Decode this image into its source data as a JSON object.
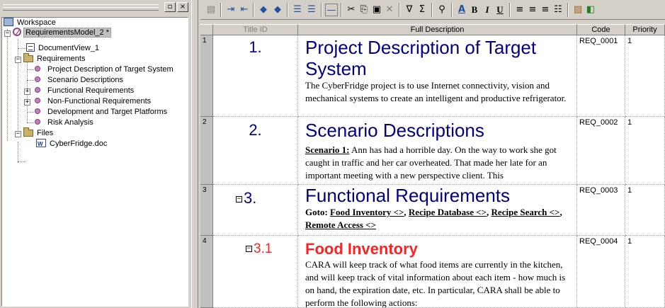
{
  "left_panel": {
    "close_label": "×",
    "restore_label": "▫",
    "tree": {
      "workspace": "Workspace",
      "model": "RequirementsModel_2 *",
      "document_view": "DocumentView_1",
      "requirements": "Requirements",
      "items": [
        "Project Description of Target System",
        "Scenario Descriptions",
        "Functional Requirements",
        "Non-Functional Requirements",
        "Development and Target Platforms",
        "Risk Analysis"
      ],
      "files": "Files",
      "file": "CyberFridge.doc",
      "expand_plus": "+",
      "expand_minus": "−"
    }
  },
  "toolbar": {
    "icons": [
      "properties-icon",
      "insert-row-icon",
      "insert-col-icon",
      "arrow-left-icon",
      "arrow-right-icon",
      "align-left-icon",
      "align-center-icon",
      "line-icon",
      "cut-icon",
      "copy-icon",
      "paste-icon",
      "delete-icon",
      "filter-icon",
      "sum-icon",
      "find-icon",
      "font-color-icon",
      "bold-icon",
      "italic-icon",
      "underline-icon",
      "align-justify-icon",
      "align-center2-icon",
      "align-right-icon",
      "bullets-icon",
      "image-icon",
      "export-icon"
    ],
    "glyphs": {
      "bold": "B",
      "italic": "I",
      "underline": "U",
      "font_color": "A"
    }
  },
  "grid": {
    "columns": {
      "title_id": "Title ID",
      "full_description": "Full Description",
      "code": "Code",
      "priority": "Priority"
    },
    "rows": [
      {
        "row_num": "1",
        "title_num": "1.",
        "heading": "Project Description of Target System",
        "text": "The CyberFridge project is to use Internet connectivity, vision and mechanical systems to create an intelligent and productive refrigerator.",
        "code": "REQ_0001",
        "priority": "1"
      },
      {
        "row_num": "2",
        "title_num": "2.",
        "heading": "Scenario Descriptions",
        "scenario_label": "Scenario 1:",
        "text": " Ann has had a horrible day. On the way to work she got caught in traffic and her car overheated. That made her late for an important meeting with a new perspective client. This",
        "code": "REQ_0002",
        "priority": "1"
      },
      {
        "row_num": "3",
        "title_num": "3.",
        "heading": "Functional Requirements",
        "goto_label": "Goto:",
        "links": [
          "Food Inventory <>",
          "Recipe Database <>",
          "Recipe Search <>",
          "Remote Access <>"
        ],
        "code": "REQ_0003",
        "priority": "1"
      },
      {
        "row_num": "4",
        "title_num": "3.1",
        "heading": "Food Inventory",
        "text": "CARA will keep track of what food items are currently in the kitchen, and will keep track of vital information about each item - how much is on hand, the expiration date, etc. In particular, CARA shall be able to perform the following actions:",
        "code": "REQ_0004",
        "priority": "1"
      }
    ],
    "collapse_glyph": "−"
  },
  "colors": {
    "heading_blue": "#000080",
    "heading_red": "#ff2020",
    "chrome": "#d4d0c8"
  }
}
